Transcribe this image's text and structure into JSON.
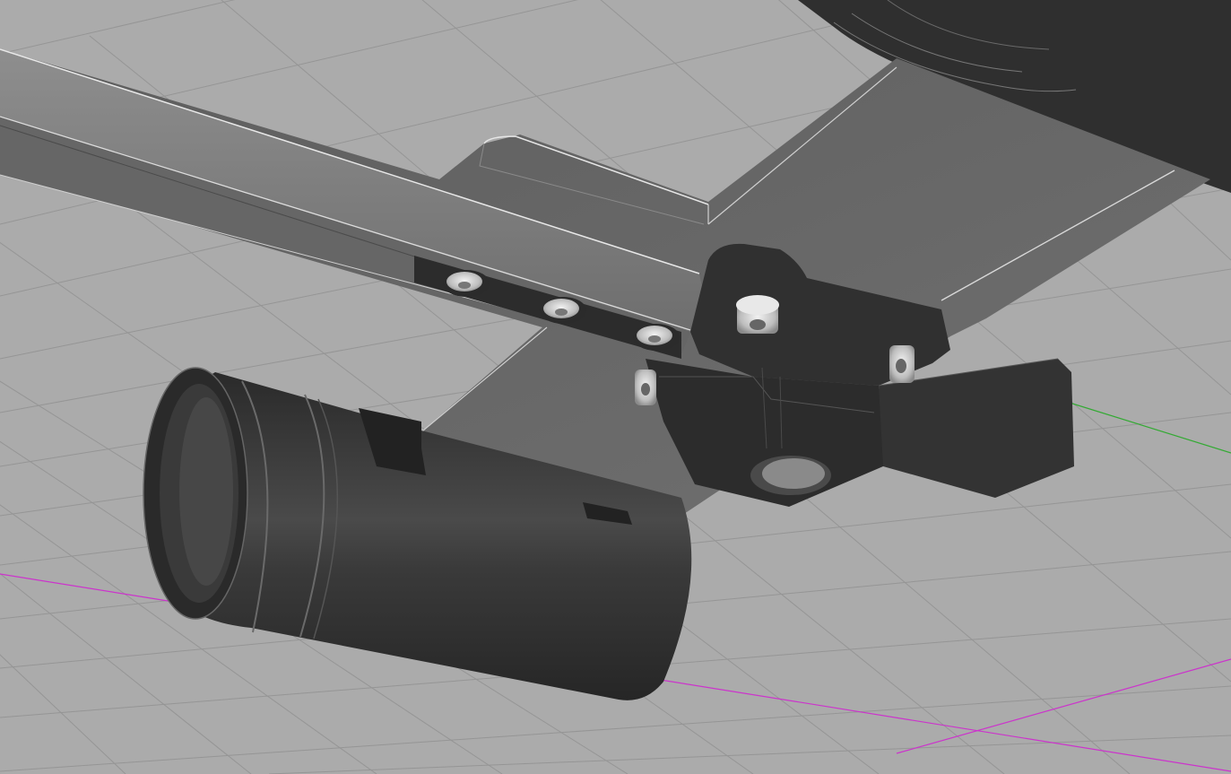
{
  "viewport": {
    "background": "#ababab",
    "grid_color": "#8f8f8f",
    "axis_x_color": "#cc33cc",
    "axis_y_color": "#33aa33"
  },
  "model": {
    "rail_color": "#7c7c7c",
    "rail_highlight": "#d8d8d8",
    "plate_color": "#6a6a6a",
    "part_dark": "#2e2e2e",
    "part_mid": "#3c3c3c",
    "screw_color": "#cfcfcf"
  }
}
